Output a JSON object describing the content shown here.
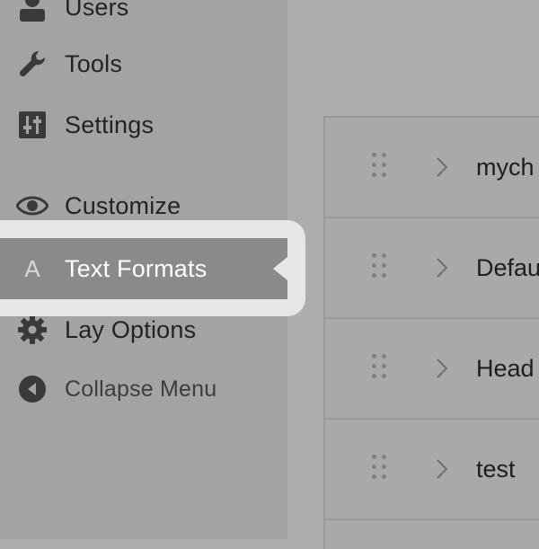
{
  "sidebar": {
    "items": [
      {
        "label": "Users",
        "icon": "user-icon"
      },
      {
        "label": "Tools",
        "icon": "wrench-icon"
      },
      {
        "label": "Settings",
        "icon": "settings-sliders-icon"
      },
      {
        "label": "Customize",
        "icon": "eye-icon"
      },
      {
        "label": "Text Formats",
        "icon": "letter-a-icon",
        "icon_text": "A",
        "active": true
      },
      {
        "label": "Lay Options",
        "icon": "gear-icon"
      },
      {
        "label": "Collapse Menu",
        "icon": "collapse-arrow-icon"
      }
    ]
  },
  "content": {
    "rows": [
      {
        "name": "mych"
      },
      {
        "name": "Defau"
      },
      {
        "name": "Head"
      },
      {
        "name": "test"
      }
    ]
  },
  "colors": {
    "background": "#adadad",
    "sidebar": "#a3a3a3",
    "active_item": "#8a8a8a",
    "highlight_card": "#e6e6e6"
  }
}
